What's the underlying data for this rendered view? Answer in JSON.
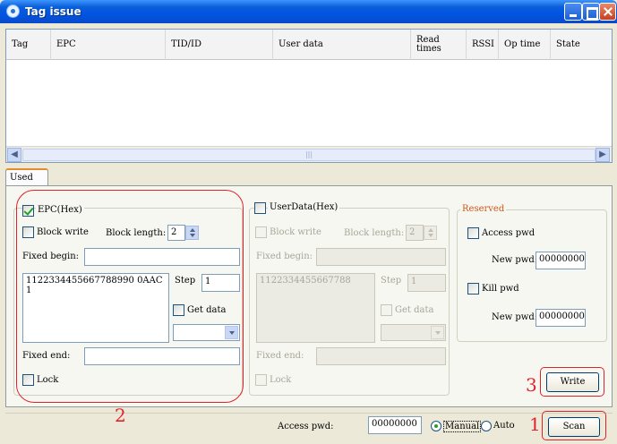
{
  "window": {
    "title": "Tag issue"
  },
  "table": {
    "columns": [
      "Tag",
      "EPC",
      "TID/ID",
      "User data",
      "Read times",
      "RSSI",
      "Op time",
      "State"
    ]
  },
  "tabs": {
    "active": "Used"
  },
  "epc": {
    "checkbox_label": "EPC(Hex)",
    "block_write_label": "Block write",
    "block_length_label": "Block length:",
    "block_length_value": "2",
    "fixed_begin_label": "Fixed begin:",
    "fixed_begin_value": "",
    "data_value": "1122334455667788990 0AAC1",
    "step_label": "Step",
    "step_value": "1",
    "get_data_label": "Get data",
    "fixed_end_label": "Fixed end:",
    "fixed_end_value": "",
    "lock_label": "Lock"
  },
  "userdata": {
    "checkbox_label": "UserData(Hex)",
    "block_write_label": "Block write",
    "block_length_label": "Block length:",
    "block_length_value": "2",
    "fixed_begin_label": "Fixed begin:",
    "data_value": "1122334455667788",
    "step_label": "Step",
    "step_value": "1",
    "get_data_label": "Get data",
    "fixed_end_label": "Fixed end:",
    "lock_label": "Lock"
  },
  "reserved": {
    "legend": "Reserved",
    "access_pwd_label": "Access pwd",
    "access_new_pwd_label": "New pwd:",
    "access_new_pwd_value": "00000000",
    "kill_pwd_label": "Kill pwd",
    "kill_new_pwd_label": "New pwd:",
    "kill_new_pwd_value": "00000000"
  },
  "buttons": {
    "write": "Write",
    "scan": "Scan"
  },
  "footer": {
    "access_pwd_label": "Access pwd:",
    "access_pwd_value": "00000000",
    "manual_label": "Manual",
    "auto_label": "Auto"
  },
  "annotations": {
    "one": "1",
    "two": "2",
    "three": "3"
  }
}
